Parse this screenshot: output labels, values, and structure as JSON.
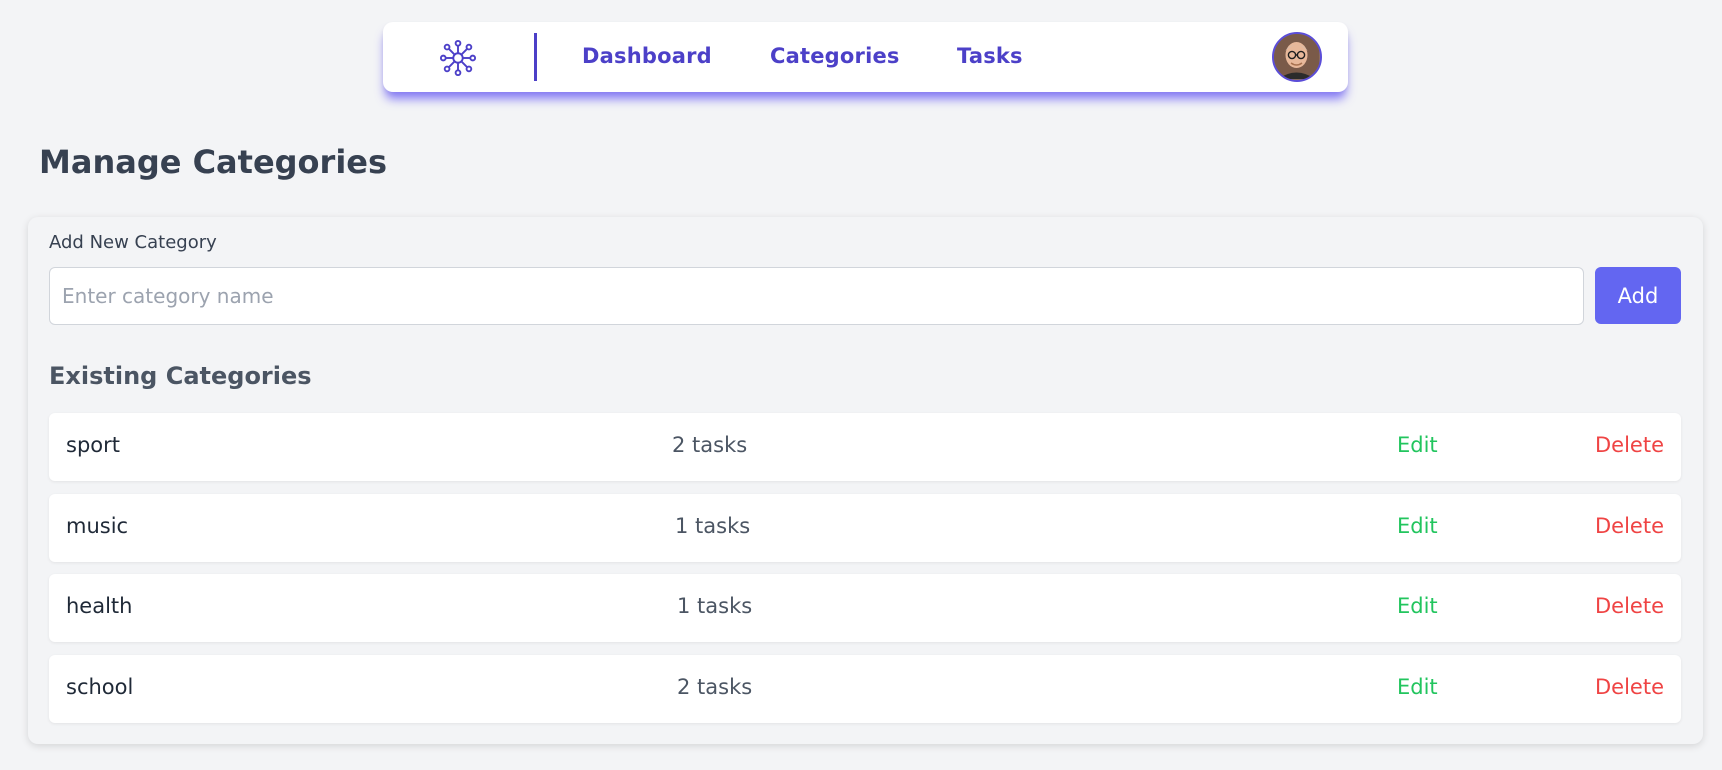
{
  "nav": {
    "logo_icon": "network-nodes-icon",
    "links": [
      {
        "label": "Dashboard"
      },
      {
        "label": "Categories"
      },
      {
        "label": "Tasks"
      }
    ],
    "avatar_icon": "user-avatar",
    "accent_color": "#4c40c8"
  },
  "page": {
    "title": "Manage Categories"
  },
  "form": {
    "label": "Add New Category",
    "input_value": "",
    "placeholder": "Enter category name",
    "add_button": "Add",
    "button_color": "#6366f1"
  },
  "list": {
    "heading": "Existing Categories",
    "edit_color": "#22c55e",
    "delete_color": "#ef4444",
    "items": [
      {
        "name": "sport",
        "count": "2 tasks",
        "edit": "Edit",
        "delete": "Delete"
      },
      {
        "name": "music",
        "count": "1 tasks",
        "edit": "Edit",
        "delete": "Delete"
      },
      {
        "name": "health",
        "count": "1 tasks",
        "edit": "Edit",
        "delete": "Delete"
      },
      {
        "name": "school",
        "count": "2 tasks",
        "edit": "Edit",
        "delete": "Delete"
      }
    ]
  }
}
